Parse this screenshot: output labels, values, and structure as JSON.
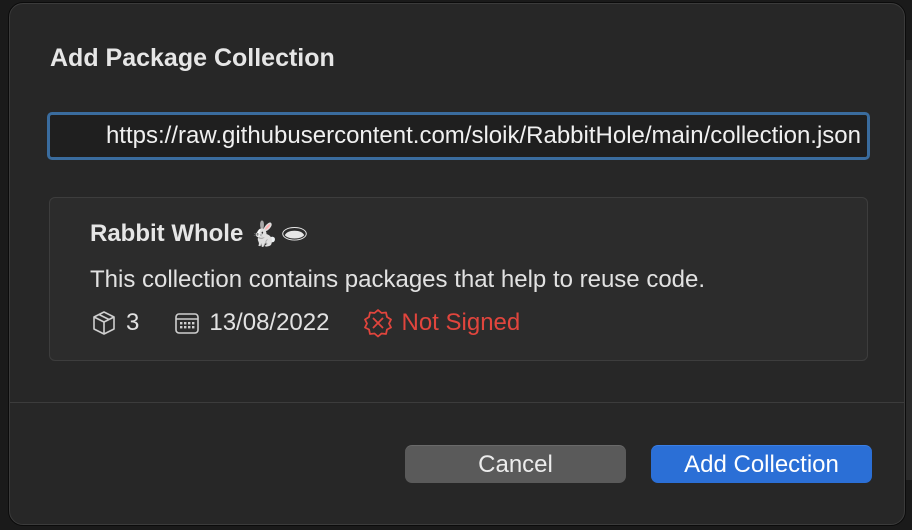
{
  "dialog": {
    "title": "Add Package Collection",
    "url_value": "https://raw.githubusercontent.com/sloik/RabbitHole/main/collection.json",
    "collection": {
      "name": "Rabbit Whole",
      "name_emoji": "🐇🕳",
      "description": "This collection contains packages that help to reuse code.",
      "package_count": "3",
      "package_icon": "package-icon",
      "date": "13/08/2022",
      "date_icon": "calendar-icon",
      "signature_status": "Not Signed",
      "signature_icon": "x-badge-icon"
    },
    "buttons": {
      "cancel_label": "Cancel",
      "add_label": "Add Collection"
    }
  },
  "colors": {
    "accent": "#2b6fd6",
    "focus_ring": "#3a6c9e",
    "warning": "#e1453d",
    "dialog_bg": "#272727"
  }
}
